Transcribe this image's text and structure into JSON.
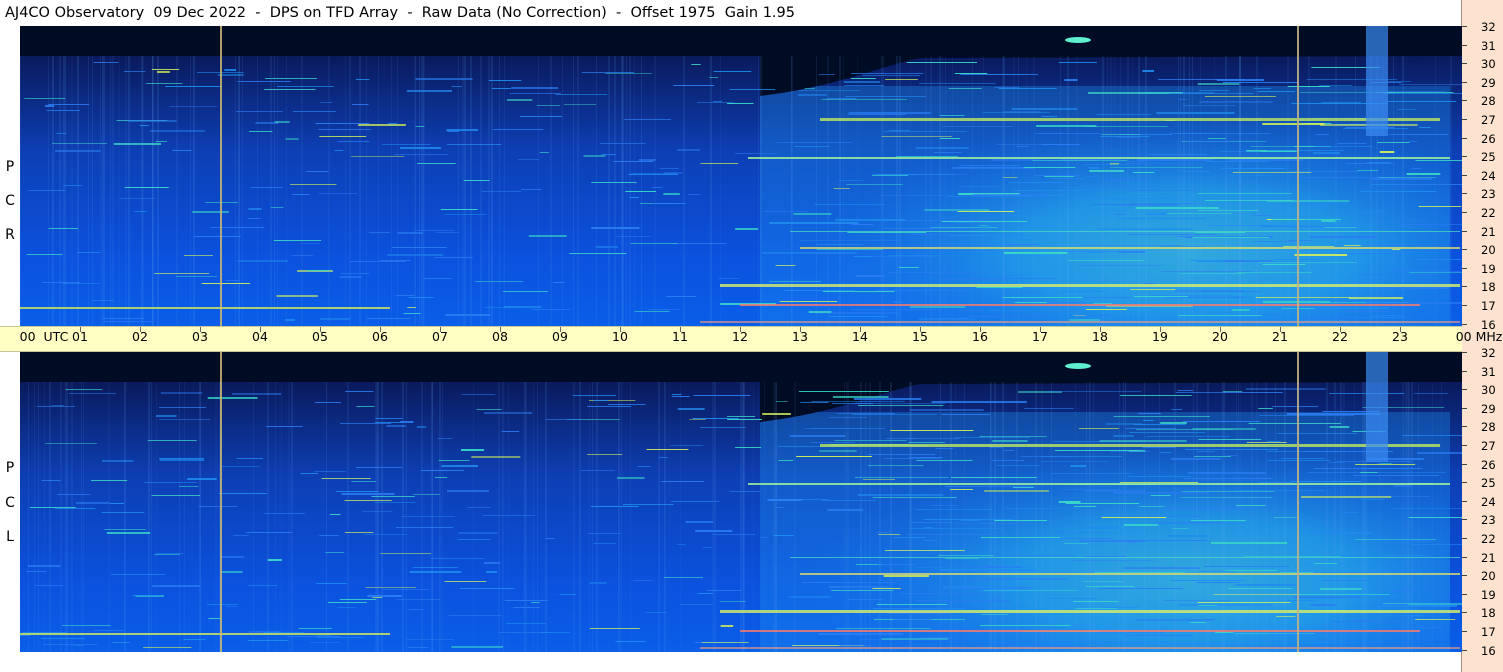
{
  "title": "AJ4CO Observatory  09 Dec 2022  -  DPS on TFD Array  -  Raw Data (No Correction)  -  Offset 1975  Gain 1.95",
  "panels": [
    {
      "label_letters": [
        "R",
        "C",
        "P"
      ]
    },
    {
      "label_letters": [
        "L",
        "C",
        "P"
      ]
    }
  ],
  "freq_axis": {
    "unit": "MHz",
    "ticks": [
      "32",
      "31",
      "30",
      "29",
      "28",
      "27",
      "26",
      "25",
      "24",
      "23",
      "22",
      "21",
      "20",
      "19",
      "18",
      "17",
      "16"
    ]
  },
  "time_axis": {
    "start_label": "00  UTC",
    "end_label": "00 MHz",
    "ticks": [
      "01",
      "02",
      "03",
      "04",
      "05",
      "06",
      "07",
      "08",
      "09",
      "10",
      "11",
      "12",
      "13",
      "14",
      "15",
      "16",
      "17",
      "18",
      "19",
      "20",
      "21",
      "22",
      "23"
    ]
  },
  "colors": {
    "background_dark": "#000b24",
    "band_low": "#0a4fd6",
    "band_mid": "#1f8cf0",
    "band_high": "#3ad9c8",
    "band_peak": "#d6f25a",
    "vertical_marker": "#cdb873",
    "time_bar": "#ffffc4",
    "right_column": "#fde3cf"
  }
}
